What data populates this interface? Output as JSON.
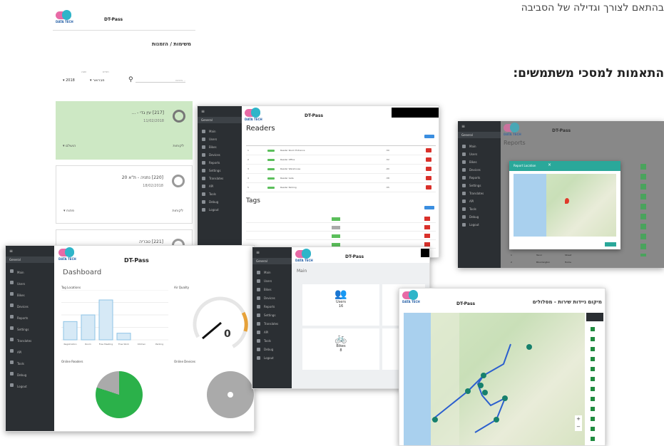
{
  "page": {
    "top_text": "בהתאם לצורך וגדילה של הסביבה",
    "section_heading": "התאמות למסכי משתמשים:"
  },
  "brand": {
    "name": "DT-Pass",
    "logo_text": "DATA TECH"
  },
  "sidebar": {
    "section": "General",
    "items": [
      "Main",
      "Users",
      "Bikes",
      "Devices",
      "Reports",
      "Settings",
      "Translates",
      "API",
      "Tools",
      "Debug",
      "Logout"
    ]
  },
  "mobile": {
    "title": "משימות / הזמנות",
    "search_placeholder": "חיפוש...",
    "month_label": "חודש",
    "month_value": "פברואר",
    "year_label": "שנה",
    "year_value": "2018",
    "tasks": [
      {
        "title": "[217] עין גדי - ...",
        "date": "11/02/2018",
        "status": "הושלם",
        "action": "לקוחות"
      },
      {
        "title": "[220] נתניה - ת\"א 20",
        "date": "18/02/2018",
        "status": "פתוח",
        "action": "לקוחות"
      },
      {
        "title": "[221] טבריה",
        "date": "",
        "status": "",
        "action": ""
      }
    ]
  },
  "readers_screen": {
    "title": "Readers",
    "tags_title": "Tags",
    "add_label": "Add",
    "readers_rows": [
      {
        "id": "1",
        "type": "",
        "status": "",
        "label": "Reader Room Entrance",
        "location": "",
        "mac": "",
        "rssi": "-50"
      },
      {
        "id": "2",
        "type": "",
        "status": "",
        "label": "Reader Office",
        "location": "",
        "mac": "",
        "rssi": "-52"
      },
      {
        "id": "3",
        "type": "",
        "status": "",
        "label": "Reader Warehouse",
        "location": "",
        "mac": "",
        "rssi": "-60"
      },
      {
        "id": "4",
        "type": "",
        "status": "",
        "label": "Reader Gate",
        "location": "",
        "mac": "",
        "rssi": "-58"
      },
      {
        "id": "5",
        "type": "",
        "status": "",
        "label": "Reader Parking",
        "location": "",
        "mac": "",
        "rssi": "-55"
      }
    ]
  },
  "reports_screen": {
    "title": "Reports",
    "modal_title": "Report Location",
    "close": "×",
    "footer": "Close",
    "rows": [
      {
        "id": "1",
        "name": "Tavor",
        "place": "Street"
      },
      {
        "id": "2",
        "name": "Bloomington",
        "place": "Home"
      },
      {
        "id": "3",
        "name": "Bloomington",
        "place": "Field"
      }
    ]
  },
  "dashboard": {
    "title": "Dashboard",
    "tag_locations": "Tag Locations",
    "air_quality": "Air Quality",
    "online_readers": "Online Readers",
    "online_devices": "Online Devices",
    "gauge_value": "0",
    "chart_data": {
      "type": "bar",
      "categories": [
        "Registration",
        "Room",
        "Free Meeting",
        "Free Work",
        "Kitchen",
        "Parking"
      ],
      "values": [
        22,
        30,
        48,
        8,
        0,
        0
      ],
      "ylim": [
        0,
        60
      ]
    },
    "pie_readers": {
      "online": 80,
      "offline": 20
    },
    "pie_devices": {
      "online": 0,
      "offline": 100
    }
  },
  "main_screen": {
    "title": "Main",
    "tiles": [
      {
        "label": "Users",
        "value": "16"
      },
      {
        "label": "Bikes",
        "value": "8"
      }
    ]
  },
  "map_screen": {
    "title": "מיקום ניידות שירות - מסלולים"
  },
  "colors": {
    "sidebar": "#2b2f33",
    "green": "#4aa35c",
    "red": "#d9302a",
    "pink": "#e86aa6",
    "teal": "#2fb5c9"
  }
}
